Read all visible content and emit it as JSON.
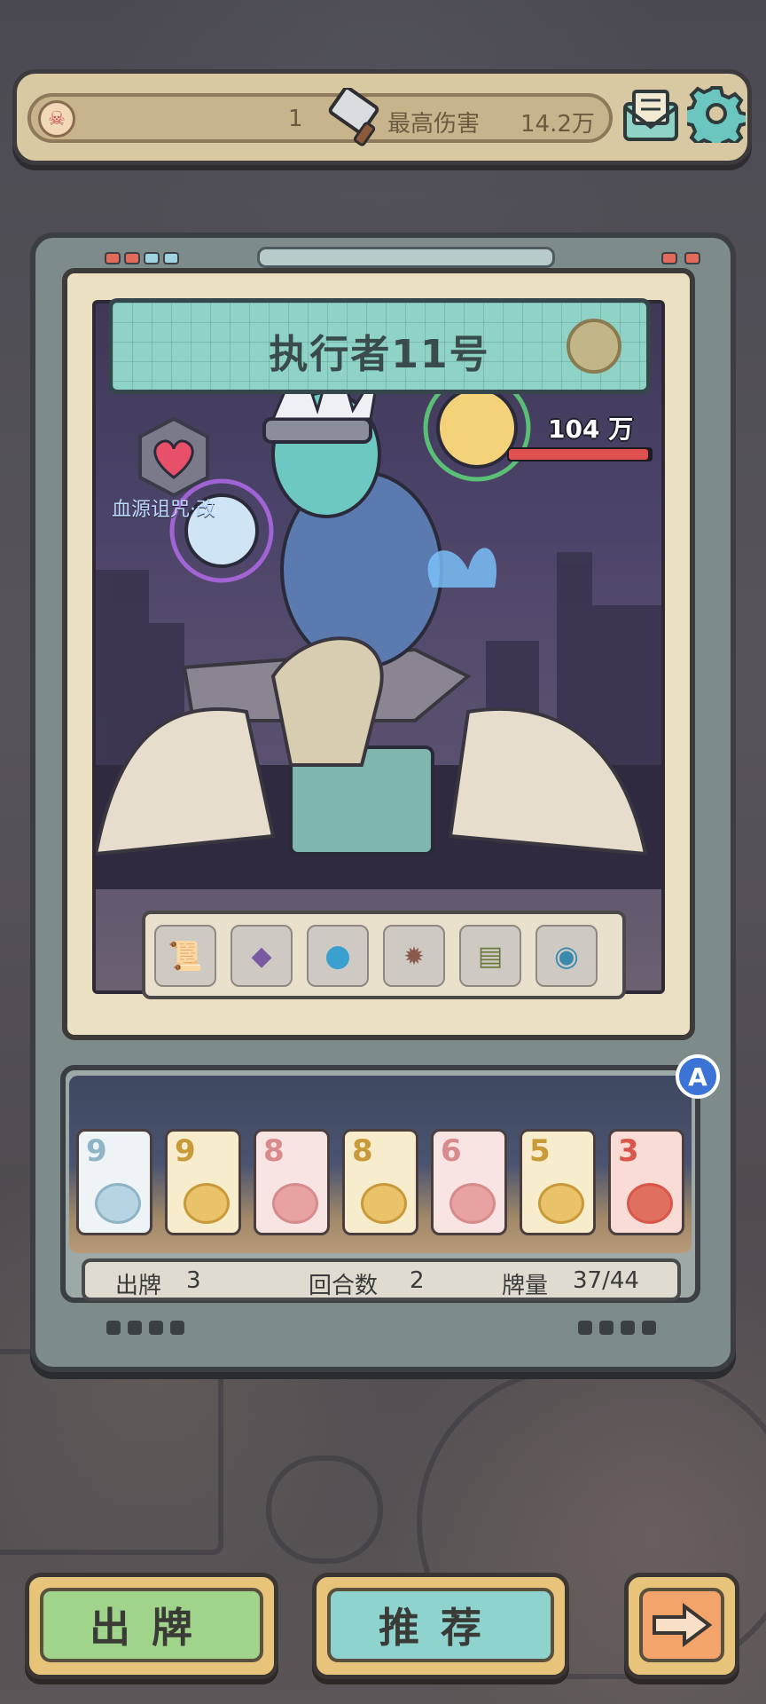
{
  "top_bar": {
    "level": "1",
    "max_damage_label": "最高伤害",
    "max_damage_value": "14.2万"
  },
  "boss": {
    "name": "执行者11号",
    "hp": "104 万",
    "hp_fraction": 0.98
  },
  "buff": {
    "label": "血源诅咒·改",
    "icon": "heart-icon"
  },
  "items": [
    "scroll-icon",
    "crystal-icon",
    "blue-orb-icon",
    "bomb-scroll-icon",
    "cash-icon",
    "eye-orb-icon"
  ],
  "auto_button": "A",
  "hand": {
    "cards": [
      {
        "value": "9",
        "color": "#8fb4c6",
        "bg": "#eef4f6",
        "face": "ghost"
      },
      {
        "value": "9",
        "color": "#c99a3a",
        "bg": "#f7eccc",
        "face": "angel"
      },
      {
        "value": "8",
        "color": "#d98a8a",
        "bg": "#f9e4e4",
        "face": "pig"
      },
      {
        "value": "8",
        "color": "#c99a3a",
        "bg": "#f7eccc",
        "face": "angel"
      },
      {
        "value": "6",
        "color": "#d98a8a",
        "bg": "#f9e4e4",
        "face": "pig"
      },
      {
        "value": "5",
        "color": "#c99a3a",
        "bg": "#f7eccc",
        "face": "angel"
      },
      {
        "value": "3",
        "color": "#d9574a",
        "bg": "#f9dcd6",
        "face": "devil"
      }
    ],
    "played_label": "出牌",
    "played_value": "3",
    "rounds_label": "回合数",
    "rounds_value": "2",
    "deck_label": "牌量",
    "deck_value": "37/44"
  },
  "buttons": {
    "play": "出牌",
    "recommend": "推荐"
  }
}
